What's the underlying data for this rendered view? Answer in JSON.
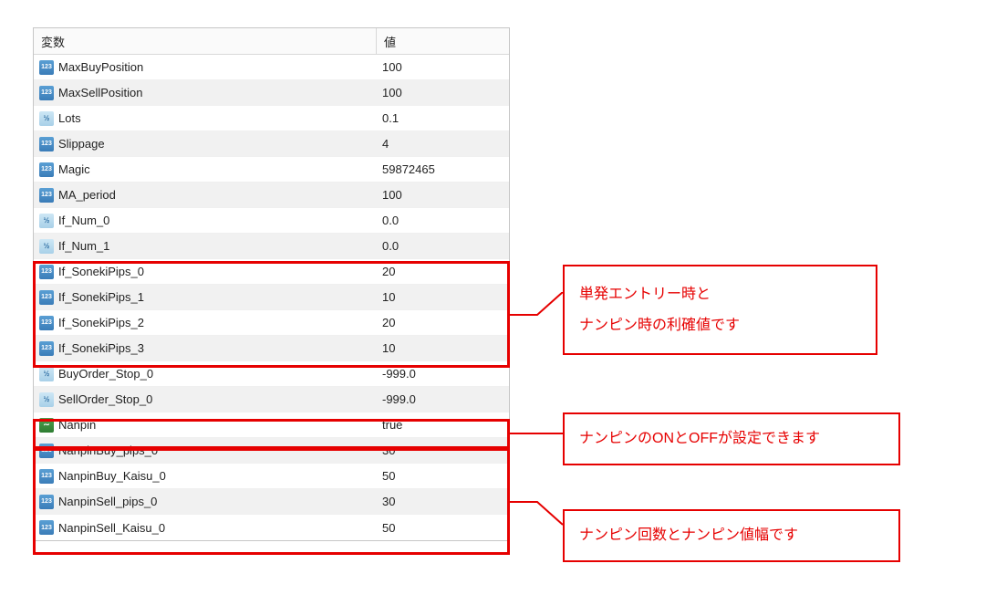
{
  "headers": {
    "variable": "変数",
    "value": "値"
  },
  "rows": [
    {
      "icon": "123",
      "name": "MaxBuyPosition",
      "value": "100",
      "alt": false
    },
    {
      "icon": "123",
      "name": "MaxSellPosition",
      "value": "100",
      "alt": true
    },
    {
      "icon": "v2",
      "name": "Lots",
      "value": "0.1",
      "alt": false
    },
    {
      "icon": "123",
      "name": "Slippage",
      "value": "4",
      "alt": true
    },
    {
      "icon": "123",
      "name": "Magic",
      "value": "59872465",
      "alt": false
    },
    {
      "icon": "123",
      "name": "MA_period",
      "value": "100",
      "alt": true
    },
    {
      "icon": "v2",
      "name": "If_Num_0",
      "value": "0.0",
      "alt": false
    },
    {
      "icon": "v2",
      "name": "If_Num_1",
      "value": "0.0",
      "alt": true
    },
    {
      "icon": "123",
      "name": "If_SonekiPips_0",
      "value": "20",
      "alt": false
    },
    {
      "icon": "123",
      "name": "If_SonekiPips_1",
      "value": "10",
      "alt": true
    },
    {
      "icon": "123",
      "name": "If_SonekiPips_2",
      "value": "20",
      "alt": false
    },
    {
      "icon": "123",
      "name": "If_SonekiPips_3",
      "value": "10",
      "alt": true
    },
    {
      "icon": "v2",
      "name": "BuyOrder_Stop_0",
      "value": "-999.0",
      "alt": false
    },
    {
      "icon": "v2",
      "name": "SellOrder_Stop_0",
      "value": "-999.0",
      "alt": true
    },
    {
      "icon": "fx",
      "name": "Nanpin",
      "value": "true",
      "alt": false
    },
    {
      "icon": "123",
      "name": "NanpinBuy_pips_0",
      "value": "30",
      "alt": true
    },
    {
      "icon": "123",
      "name": "NanpinBuy_Kaisu_0",
      "value": "50",
      "alt": false
    },
    {
      "icon": "123",
      "name": "NanpinSell_pips_0",
      "value": "30",
      "alt": true
    },
    {
      "icon": "123",
      "name": "NanpinSell_Kaisu_0",
      "value": "50",
      "alt": false
    }
  ],
  "callouts": {
    "c1_line1": "単発エントリー時と",
    "c1_line2": "ナンピン時の利確値です",
    "c2": "ナンピンのONとOFFが設定できます",
    "c3": "ナンピン回数とナンピン値幅です"
  }
}
